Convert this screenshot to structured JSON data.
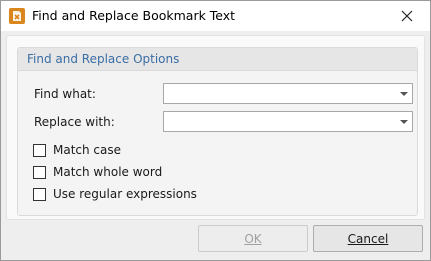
{
  "window": {
    "title": "Find and Replace Bookmark Text",
    "app_icon": "pdf-xchange-icon",
    "close_icon": "close-icon"
  },
  "group": {
    "title": "Find and Replace Options",
    "find_label": "Find what:",
    "find_value": "",
    "replace_label": "Replace with:",
    "replace_value": "",
    "options": [
      {
        "label": "Match case",
        "checked": false
      },
      {
        "label": "Match whole word",
        "checked": false
      },
      {
        "label": "Use regular expressions",
        "checked": false
      }
    ]
  },
  "buttons": {
    "ok_label": "OK",
    "ok_enabled": false,
    "cancel_label": "Cancel"
  },
  "colors": {
    "group_title": "#3a6ea5",
    "app_icon_bg": "#d9861c"
  }
}
